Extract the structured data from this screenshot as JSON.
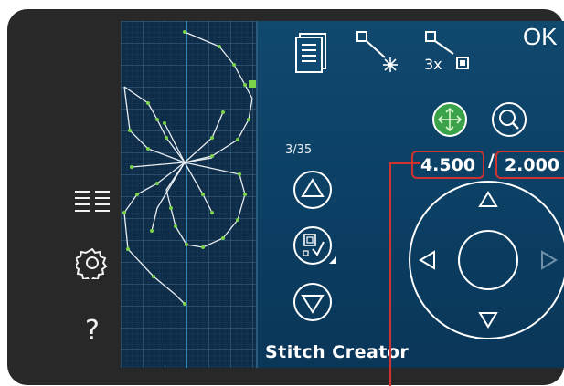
{
  "screen": {
    "title": "Stitch Creator",
    "ok_label": "OK",
    "stitch_counter": "3/35",
    "width_value": "4.500",
    "length_value": "2.000",
    "separator": "/",
    "repeat_label": "3x"
  },
  "sidebar": {
    "help_label": "?"
  },
  "colors": {
    "accent": "#d0322f",
    "stitch_point": "#7bd34a",
    "panel_blue": "#0b3f63"
  }
}
